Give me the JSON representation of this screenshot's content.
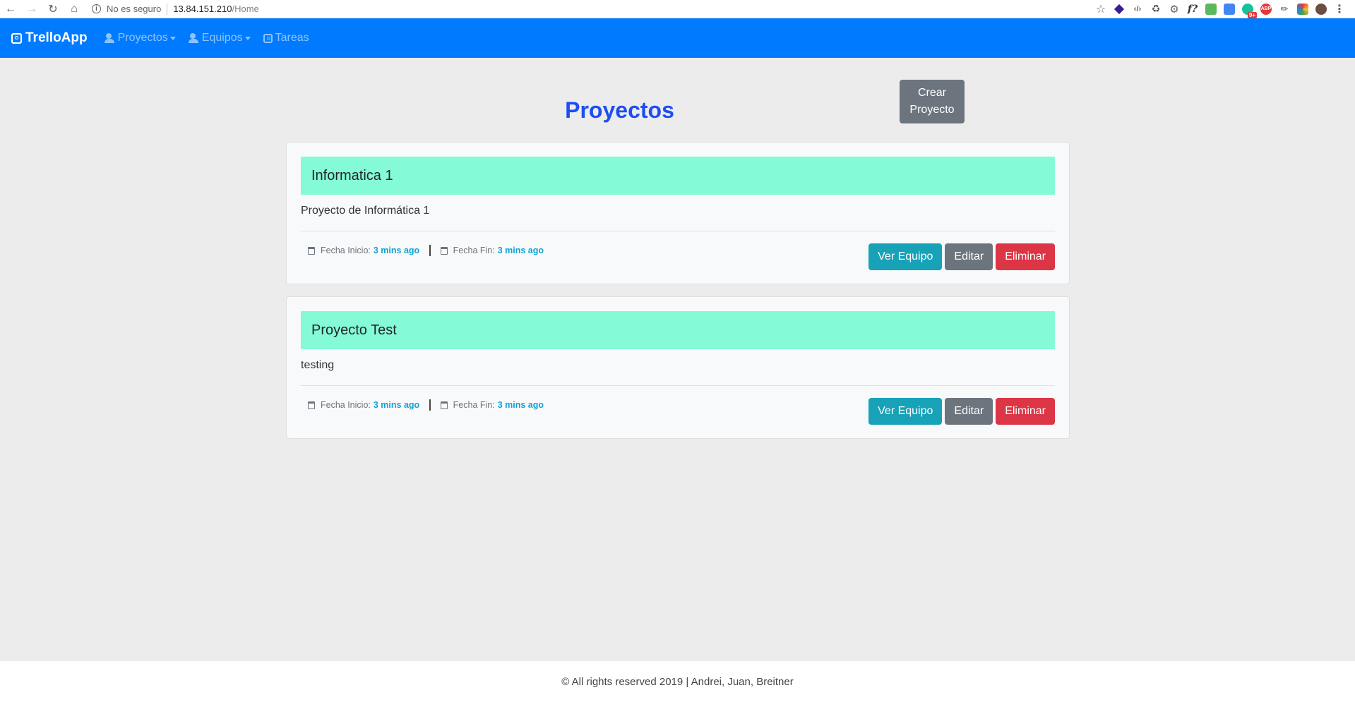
{
  "browser": {
    "security_label": "No es seguro",
    "url_host": "13.84.151.210",
    "url_path": "/Home",
    "extension_badge": "9+",
    "abp_label": "ABP",
    "fx_label": "f?",
    "code_label": "‹/›"
  },
  "navbar": {
    "brand": "TrelloApp",
    "items": [
      {
        "label": "Proyectos",
        "icon": "users-icon",
        "dropdown": true
      },
      {
        "label": "Equipos",
        "icon": "users-icon",
        "dropdown": true
      },
      {
        "label": "Tareas",
        "icon": "app-icon",
        "dropdown": false
      }
    ],
    "color": "#007bff"
  },
  "page": {
    "title": "Proyectos",
    "create_button": "Crear\nProyecto"
  },
  "projects": [
    {
      "name": "Informatica 1",
      "description": "Proyecto de Informática 1",
      "start_label": "Fecha Inicio:",
      "start_value": "3 mins ago",
      "end_label": "Fecha Fin:",
      "end_value": "3 mins ago",
      "actions": {
        "view": "Ver Equipo",
        "edit": "Editar",
        "delete": "Eliminar"
      }
    },
    {
      "name": "Proyecto Test",
      "description": "testing",
      "start_label": "Fecha Inicio:",
      "start_value": "3 mins ago",
      "end_label": "Fecha Fin:",
      "end_value": "3 mins ago",
      "actions": {
        "view": "Ver Equipo",
        "edit": "Editar",
        "delete": "Eliminar"
      }
    }
  ],
  "footer": {
    "text": "© All rights reserved 2019 | Andrei, Juan, Breitner"
  },
  "colors": {
    "title": "#1e4ef2",
    "card_header": "#84fbd6",
    "info": "#17a2b8",
    "secondary": "#6c757d",
    "danger": "#dc3545"
  }
}
